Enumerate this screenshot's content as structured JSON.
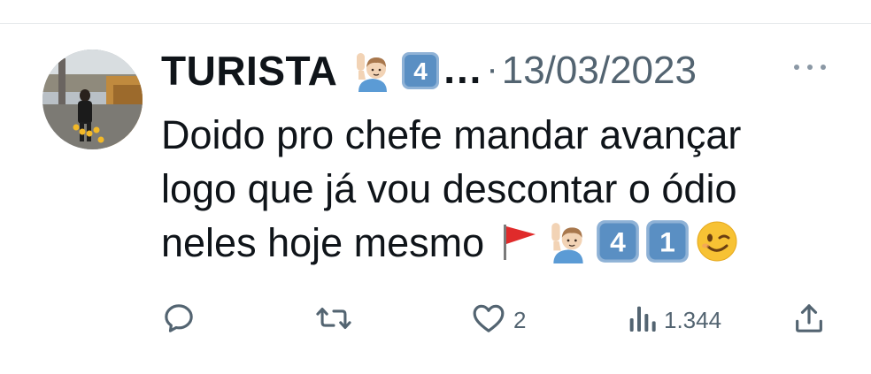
{
  "tweet": {
    "author": {
      "display_name": "TURISTA",
      "name_emojis": [
        "raising-hand-man-emoji",
        "keycap-4-emoji"
      ],
      "name_keycap_digit": "4",
      "truncation": "…"
    },
    "separator": "·",
    "timestamp": "13/03/2023",
    "text_lines": [
      "Doido pro chefe mandar avançar",
      "logo que já vou descontar o ódio",
      "neles hoje mesmo"
    ],
    "trailing_emojis": [
      "red-flag-emoji",
      "raising-hand-man-emoji",
      "keycap-4-emoji",
      "keycap-1-emoji",
      "winking-face-emoji"
    ],
    "keycap_digits": [
      "4",
      "1"
    ],
    "actions": {
      "reply": {
        "icon": "reply-icon",
        "count": ""
      },
      "retweet": {
        "icon": "retweet-icon",
        "count": ""
      },
      "like": {
        "icon": "heart-icon",
        "count": "2"
      },
      "views": {
        "icon": "views-icon",
        "count": "1.344"
      },
      "share": {
        "icon": "share-icon"
      }
    },
    "colors": {
      "text": "#0f1419",
      "muted": "#536471",
      "keycap": "#5a8fc3",
      "flag": "#e02b2b"
    }
  }
}
